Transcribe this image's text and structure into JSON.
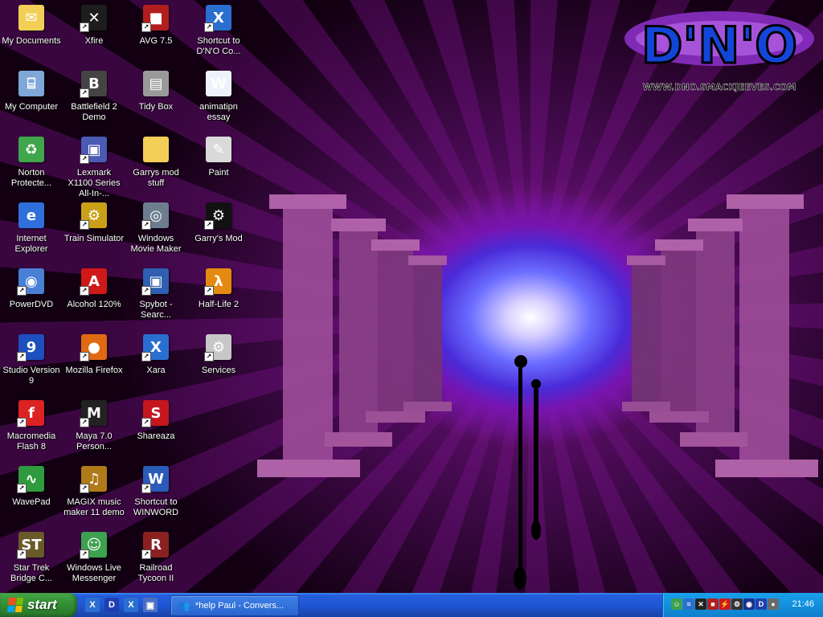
{
  "wallpaper": {
    "logo_text": "D'N'O",
    "logo_url": "WWW.DNO.SMACKJEEVES.COM"
  },
  "desktop_icons": [
    {
      "label": "My Documents",
      "icon": "folder-documents-icon",
      "color": "#f4cf57",
      "glyph": "✉",
      "shortcut": false
    },
    {
      "label": "My Computer",
      "icon": "computer-icon",
      "color": "#7fa7d8",
      "glyph": "⌸",
      "shortcut": false
    },
    {
      "label": "Norton Protecte...",
      "icon": "recycle-bin-icon",
      "color": "#3fa64b",
      "glyph": "♻",
      "shortcut": false
    },
    {
      "label": "Internet Explorer",
      "icon": "internet-explorer-icon",
      "color": "#2f6fdc",
      "glyph": "e",
      "shortcut": false
    },
    {
      "label": "PowerDVD",
      "icon": "powerdvd-icon",
      "color": "#4a7fd6",
      "glyph": "◉",
      "shortcut": true
    },
    {
      "label": "Studio Version 9",
      "icon": "studio-icon",
      "color": "#1e4fbf",
      "glyph": "9",
      "shortcut": true
    },
    {
      "label": "Macromedia Flash 8",
      "icon": "flash-icon",
      "color": "#d22",
      "glyph": "f",
      "shortcut": true
    },
    {
      "label": "WavePad",
      "icon": "wavepad-icon",
      "color": "#2f9a3e",
      "glyph": "∿",
      "shortcut": true
    },
    {
      "label": "Star Trek Bridge C...",
      "icon": "star-trek-icon",
      "color": "#6a5a2a",
      "glyph": "ST",
      "shortcut": true
    },
    {
      "label": "Xfire",
      "icon": "xfire-icon",
      "color": "#1d1d1d",
      "glyph": "✕",
      "shortcut": true
    },
    {
      "label": "Battlefield 2 Demo",
      "icon": "battlefield-icon",
      "color": "#444",
      "glyph": "B",
      "shortcut": true
    },
    {
      "label": "Lexmark X1100 Series All-In-...",
      "icon": "lexmark-icon",
      "color": "#4b5ab3",
      "glyph": "▣",
      "shortcut": true
    },
    {
      "label": "Train Simulator",
      "icon": "train-simulator-icon",
      "color": "#c9a018",
      "glyph": "⚙",
      "shortcut": true
    },
    {
      "label": "Alcohol 120%",
      "icon": "alcohol-icon",
      "color": "#d01818",
      "glyph": "A",
      "shortcut": true
    },
    {
      "label": "Mozilla Firefox",
      "icon": "firefox-icon",
      "color": "#e06a12",
      "glyph": "●",
      "shortcut": true
    },
    {
      "label": "Maya 7.0 Person...",
      "icon": "maya-icon",
      "color": "#222",
      "glyph": "M",
      "shortcut": true
    },
    {
      "label": "MAGIX music maker 11 demo",
      "icon": "magix-icon",
      "color": "#b07a18",
      "glyph": "♫",
      "shortcut": true
    },
    {
      "label": "Windows Live Messenger",
      "icon": "messenger-icon",
      "color": "#3da14f",
      "glyph": "☺",
      "shortcut": true
    },
    {
      "label": "AVG 7.5",
      "icon": "avg-icon",
      "color": "#b21e1e",
      "glyph": "■",
      "shortcut": true
    },
    {
      "label": "Tidy Box",
      "icon": "tidy-box-icon",
      "color": "#9a9a9a",
      "glyph": "▤",
      "shortcut": false
    },
    {
      "label": "Garrys mod stuff",
      "icon": "folder-icon",
      "color": "#f4cf57",
      "glyph": "",
      "shortcut": false
    },
    {
      "label": "Windows Movie Maker",
      "icon": "movie-maker-icon",
      "color": "#6d7d8f",
      "glyph": "◎",
      "shortcut": true
    },
    {
      "label": "Spybot - Searc...",
      "icon": "spybot-icon",
      "color": "#2e5fb0",
      "glyph": "▣",
      "shortcut": true
    },
    {
      "label": "Xara",
      "icon": "xara-icon",
      "color": "#2a6fd0",
      "glyph": "X",
      "shortcut": true
    },
    {
      "label": "Shareaza",
      "icon": "shareaza-icon",
      "color": "#c5161e",
      "glyph": "S",
      "shortcut": true
    },
    {
      "label": "Shortcut to WINWORD",
      "icon": "word-icon",
      "color": "#2b5bb9",
      "glyph": "W",
      "shortcut": true
    },
    {
      "label": "Railroad Tycoon II",
      "icon": "railroad-tycoon-icon",
      "color": "#8a2020",
      "glyph": "R",
      "shortcut": true
    },
    {
      "label": "Shortcut to D'N'O Co...",
      "icon": "xara-icon",
      "color": "#2a6fd0",
      "glyph": "X",
      "shortcut": true
    },
    {
      "label": "animatipn essay",
      "icon": "word-document-icon",
      "color": "#eef2fa",
      "glyph": "W",
      "shortcut": false
    },
    {
      "label": "Paint",
      "icon": "paint-icon",
      "color": "#d9d9d9",
      "glyph": "✎",
      "shortcut": false
    },
    {
      "label": "Garry's Mod",
      "icon": "steam-icon",
      "color": "#111",
      "glyph": "⚙",
      "shortcut": true
    },
    {
      "label": "Half-Life 2",
      "icon": "half-life-2-icon",
      "color": "#e58a10",
      "glyph": "λ",
      "shortcut": true
    },
    {
      "label": "Services",
      "icon": "services-icon",
      "color": "#c7c7c7",
      "glyph": "⚙",
      "shortcut": true
    }
  ],
  "taskbar": {
    "start_label": "start",
    "quick_launch": [
      {
        "icon": "xara-icon",
        "color": "#2a6fd0",
        "glyph": "X"
      },
      {
        "icon": "dno-icon",
        "color": "#1f3fb0",
        "glyph": "D"
      },
      {
        "icon": "xara-icon",
        "color": "#2a6fd0",
        "glyph": "X"
      },
      {
        "icon": "show-desktop-icon",
        "color": "#4c6fc4",
        "glyph": "▣"
      }
    ],
    "tasks": [
      {
        "label": "*help Paul - Convers...",
        "icon": "messenger-icon"
      }
    ],
    "tray_icons": [
      {
        "icon": "messenger-tray-icon",
        "color": "#3da14f",
        "glyph": "☺"
      },
      {
        "icon": "network-tray-icon",
        "color": "#2a6fd0",
        "glyph": "≡"
      },
      {
        "icon": "xfire-tray-icon",
        "color": "#222",
        "glyph": "✕"
      },
      {
        "icon": "avg-tray-icon",
        "color": "#b21e1e",
        "glyph": "■"
      },
      {
        "icon": "security-tray-icon",
        "color": "#cc1a1a",
        "glyph": "⚡"
      },
      {
        "icon": "steam-tray-icon",
        "color": "#333",
        "glyph": "⚙"
      },
      {
        "icon": "daemon-tray-icon",
        "color": "#1c2f8a",
        "glyph": "◉"
      },
      {
        "icon": "dno-tray-icon",
        "color": "#1f3fb0",
        "glyph": "D"
      },
      {
        "icon": "power-tray-icon",
        "color": "#6a6a6a",
        "glyph": "●"
      }
    ],
    "clock": "21:46"
  }
}
